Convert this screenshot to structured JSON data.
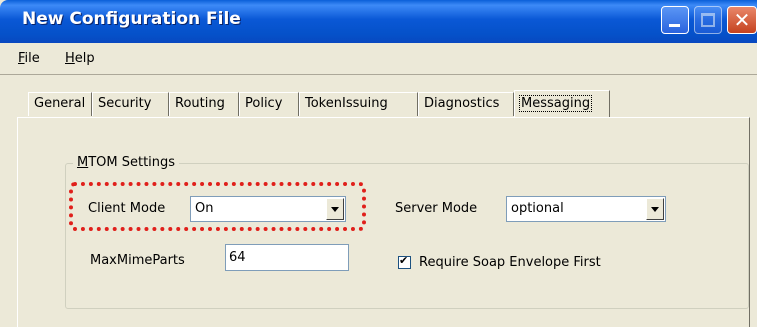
{
  "window": {
    "title": "New Configuration File"
  },
  "menu": {
    "file": "ile",
    "file_accel": "F",
    "help": "elp",
    "help_accel": "H"
  },
  "tabs": [
    {
      "label": "General",
      "active": false
    },
    {
      "label": "Security",
      "active": false
    },
    {
      "label": "Routing",
      "active": false
    },
    {
      "label": "Policy",
      "active": false
    },
    {
      "label": "TokenIssuing",
      "active": false
    },
    {
      "label": "Diagnostics",
      "active": false
    },
    {
      "label": "Messaging",
      "active": true
    }
  ],
  "mtom": {
    "group_label_accel": "M",
    "group_label_rest": "TOM Settings",
    "client_mode_label": "Client Mode",
    "client_mode_value": "On",
    "server_mode_label": "Server Mode",
    "server_mode_value": "optional",
    "max_mime_parts_label": "MaxMimeParts",
    "max_mime_parts_value": "64",
    "require_soap_label": "Require Soap Envelope First",
    "require_soap_checked": true
  },
  "colors": {
    "title_bar": "#0a58d6",
    "highlight": "#e0201b",
    "window_bg": "#ece9d8"
  }
}
